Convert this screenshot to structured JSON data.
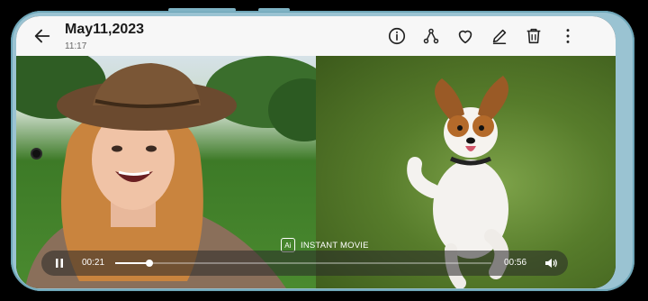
{
  "header": {
    "date_title": "May11,2023",
    "time": "11:17",
    "actions": [
      "info-icon",
      "share-icon",
      "favorite-icon",
      "edit-icon",
      "delete-icon",
      "more-icon"
    ]
  },
  "media": {
    "left_image": "woman-in-hat-selfie",
    "right_image": "papillon-dog-running"
  },
  "instant_movie": {
    "badge": "Ai",
    "label": "INSTANT MOVIE"
  },
  "player": {
    "current_time": "00:21",
    "duration": "00:56",
    "progress": 0.09
  },
  "colors": {
    "frame": "#9ac3d2",
    "topbar": "#f7f7f7"
  }
}
